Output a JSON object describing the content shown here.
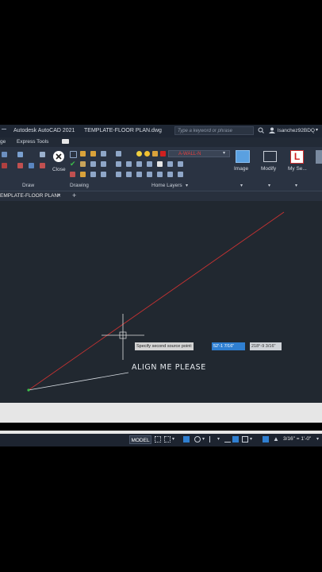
{
  "title_bar": {
    "app_title": "Autodesk AutoCAD 2021",
    "file_name": "TEMPLATE-FLOOR PLAN.dwg",
    "search_placeholder": "Type a keyword or phrase",
    "user": "lsanchez92BDQ"
  },
  "menu_tabs": [
    "ge",
    "Express Tools"
  ],
  "ribbon": {
    "close_label": "Close",
    "layer_name": "A-WALL-N",
    "panels": [
      "Draw",
      "Drawing",
      "Home Layers"
    ],
    "buttons": [
      "Image",
      "Modify",
      "My Se..."
    ]
  },
  "file_tab": {
    "label": "EMPLATE-FLOOR PLAN*",
    "add": "+"
  },
  "drawing": {
    "annotation_text": "ALIGN ME PLEASE",
    "tooltip_prompt": "Specify second source point:",
    "tooltip_value_1": "52'-1 7/16\"",
    "tooltip_value_2": "218°-9 3/16\""
  },
  "status_bar": {
    "model": "MODEL",
    "scale": "3/16\" = 1'-0\""
  },
  "colors": {
    "canvas": "#212830",
    "red_line": "#c83232",
    "accent": "#2f7fd1"
  }
}
